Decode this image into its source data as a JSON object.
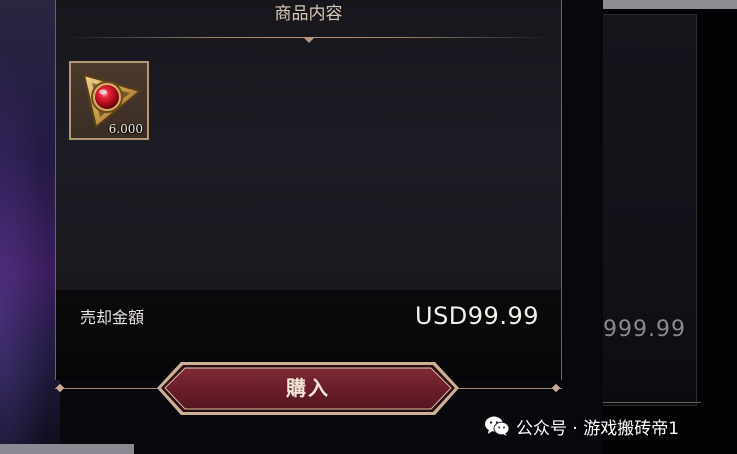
{
  "panel": {
    "title": "商品内容",
    "item": {
      "icon": "ruby-triangle-amulet-icon",
      "quantity": "6.000"
    },
    "price_label": "売却金額",
    "price_value": "USD99.99",
    "buy_label": "購入"
  },
  "background_card": {
    "price_fragment": "999.99"
  },
  "watermark": {
    "icon": "wechat-icon",
    "text": "公众号 · 游戏搬砖帝1"
  },
  "colors": {
    "accent_gold": "#b49775",
    "button_red": "#6e1f2a",
    "panel_bg": "#1a1920",
    "text_light": "#f5f0e8"
  }
}
